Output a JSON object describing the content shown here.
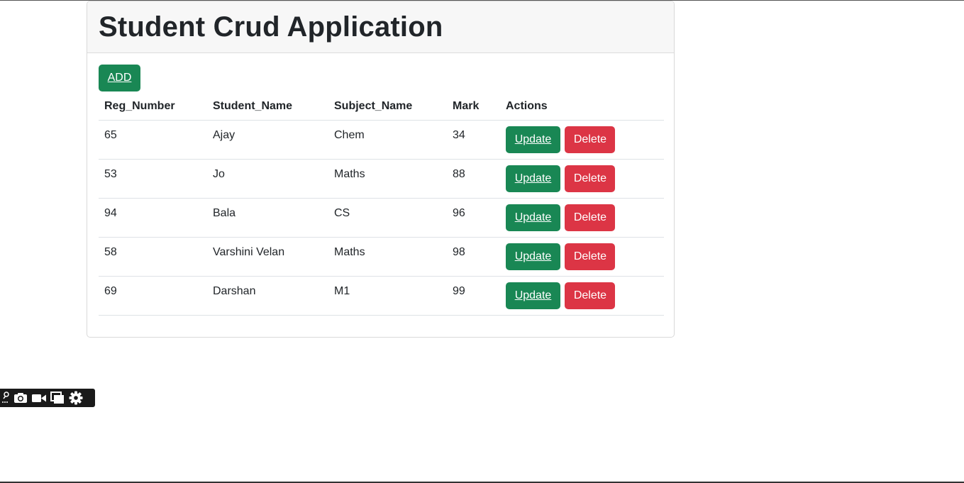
{
  "app": {
    "title": "Student Crud Application"
  },
  "toolbar": {
    "add_label": "ADD"
  },
  "table": {
    "headers": [
      "Reg_Number",
      "Student_Name",
      "Subject_Name",
      "Mark",
      "Actions"
    ],
    "rows": [
      {
        "reg": "65",
        "name": "Ajay",
        "subject": "Chem",
        "mark": "34"
      },
      {
        "reg": "53",
        "name": "Jo",
        "subject": "Maths",
        "mark": "88"
      },
      {
        "reg": "94",
        "name": "Bala",
        "subject": "CS",
        "mark": "96"
      },
      {
        "reg": "58",
        "name": "Varshini Velan",
        "subject": "Maths",
        "mark": "98"
      },
      {
        "reg": "69",
        "name": "Darshan",
        "subject": "M1",
        "mark": "99"
      }
    ],
    "update_label": "Update",
    "delete_label": "Delete"
  },
  "capture_toolbar": {
    "icons": [
      "pin-icon",
      "camera-icon",
      "video-icon",
      "window-icon",
      "gear-icon"
    ]
  },
  "colors": {
    "success": "#198754",
    "danger": "#dc3545",
    "header_bg": "#f7f7f7"
  }
}
